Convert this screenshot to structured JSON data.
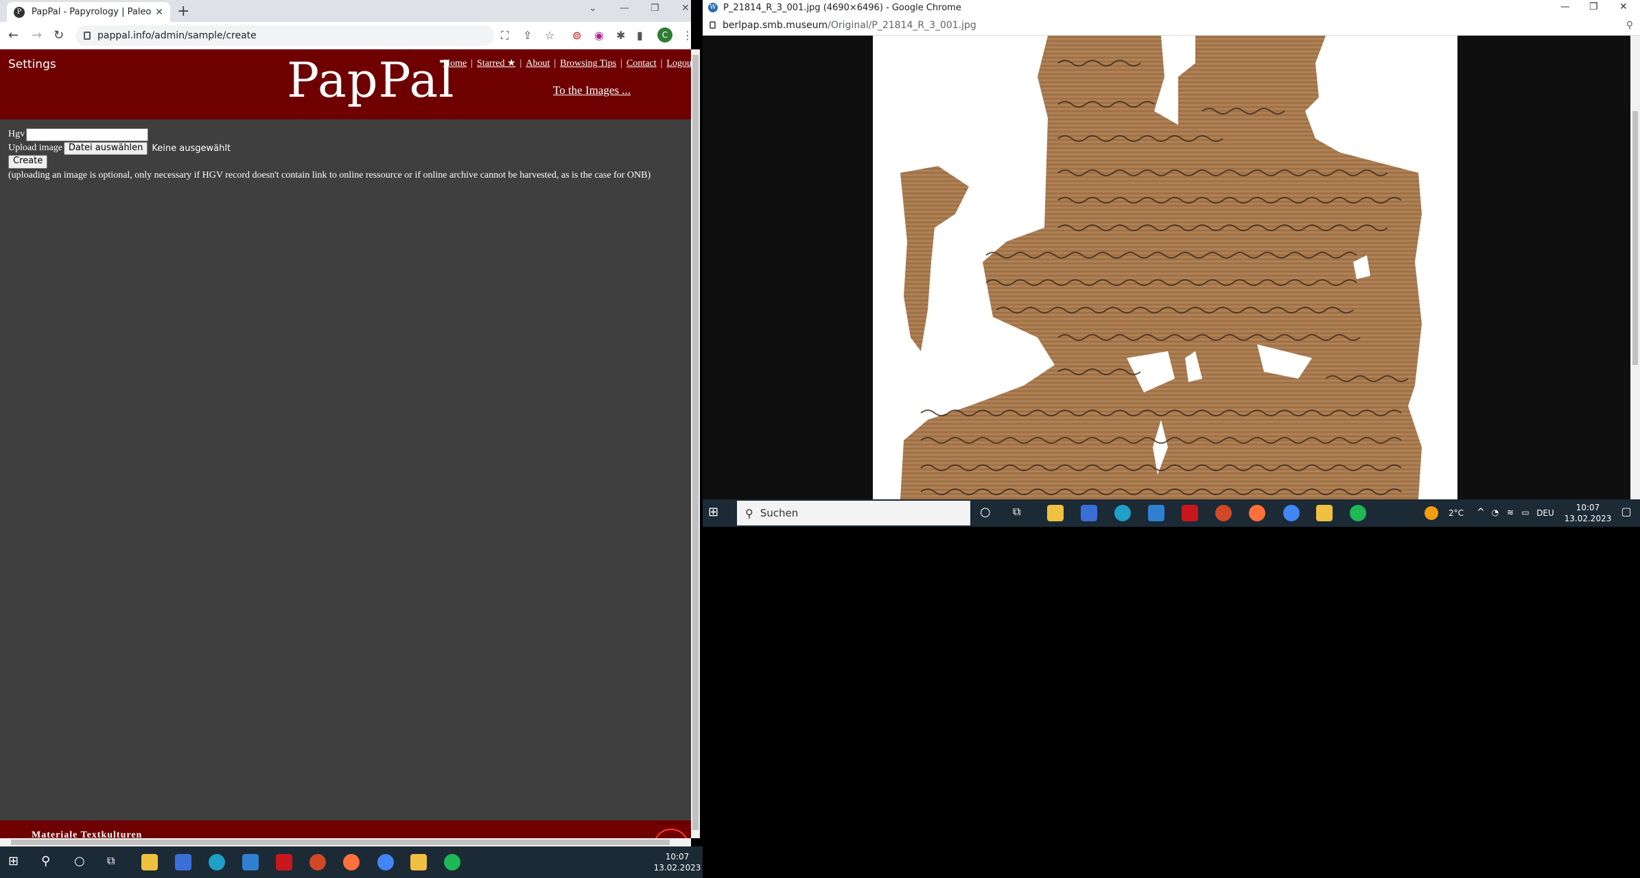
{
  "left_browser": {
    "tab_title": "PapPal - Papyrology | Paleograph",
    "url": "pappal.info/admin/sample/create",
    "profile_initial": "C"
  },
  "site": {
    "settings": "Settings",
    "logo": "PapPal",
    "nav": [
      "Home",
      "Starred ★",
      "About",
      "Browsing Tips",
      "Contact",
      "Logout"
    ],
    "to_images": "To the Images ...",
    "form": {
      "hgv_label": "Hgv",
      "upload_label": "Upload image",
      "file_button": "Datei auswählen",
      "no_file": "Keine ausgewählt",
      "create_button": "Create",
      "note": "(uploading an image is optional, only necessary if HGV record doesn't contain link to online ressource or if online archive cannot be harvested, as is the case for ONB)"
    },
    "footer_text": "Materiale Textkulturen"
  },
  "right_browser": {
    "title": "P_21814_R_3_001.jpg (4690×6496) - Google Chrome",
    "url_host": "berlpap.smb.museum",
    "url_path": "/Original/P_21814_R_3_001.jpg"
  },
  "taskbar_right": {
    "search": "Suchen",
    "weather": "2°C",
    "lang": "DEU",
    "time": "10:07",
    "date": "13.02.2023"
  },
  "taskbar_left": {
    "time": "10:07",
    "date": "13.02.2023"
  },
  "colors": {
    "header_red": "#6e0000",
    "page_gray": "#3f3f3f",
    "taskbar": "#1c2a36"
  }
}
